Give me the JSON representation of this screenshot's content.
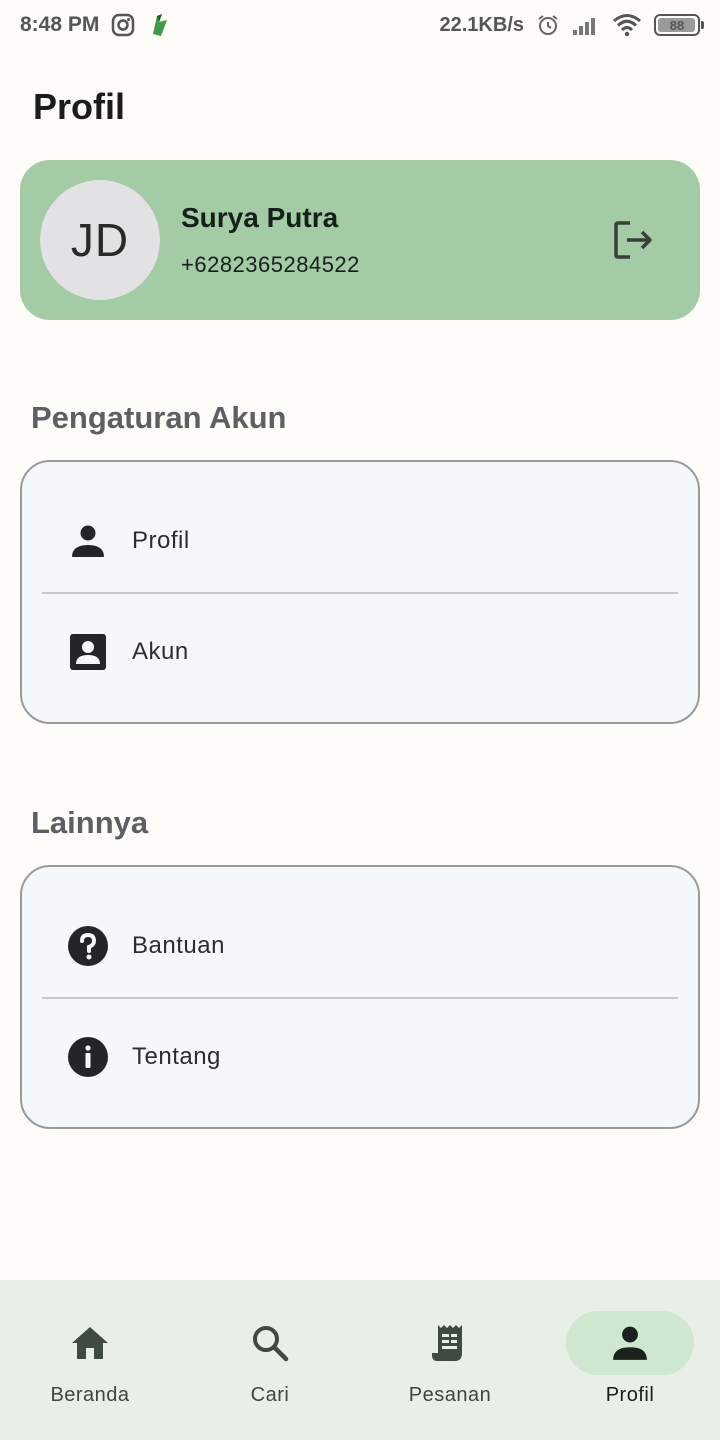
{
  "status_bar": {
    "time": "8:48 PM",
    "speed": "22.1KB/s",
    "battery": "88",
    "icons": [
      "instagram-icon",
      "app-icon",
      "alarm-icon",
      "signal-icon",
      "wifi-icon",
      "battery-icon"
    ]
  },
  "page": {
    "title": "Profil"
  },
  "profile": {
    "initials": "JD",
    "name": "Surya Putra",
    "phone": "+6282365284522",
    "card_color": "#a3cba6"
  },
  "sections": {
    "account": {
      "heading": "Pengaturan Akun",
      "items": [
        {
          "label": "Profil",
          "icon": "person-icon"
        },
        {
          "label": "Akun",
          "icon": "account-box-icon"
        }
      ]
    },
    "others": {
      "heading": "Lainnya",
      "items": [
        {
          "label": "Bantuan",
          "icon": "help-icon"
        },
        {
          "label": "Tentang",
          "icon": "info-icon"
        }
      ]
    }
  },
  "bottom_nav": {
    "items": [
      {
        "label": "Beranda",
        "icon": "home-icon"
      },
      {
        "label": "Cari",
        "icon": "search-icon"
      },
      {
        "label": "Pesanan",
        "icon": "receipt-icon"
      },
      {
        "label": "Profil",
        "icon": "person-icon"
      }
    ],
    "active": "Profil",
    "active_color": "#cfe6cf"
  }
}
